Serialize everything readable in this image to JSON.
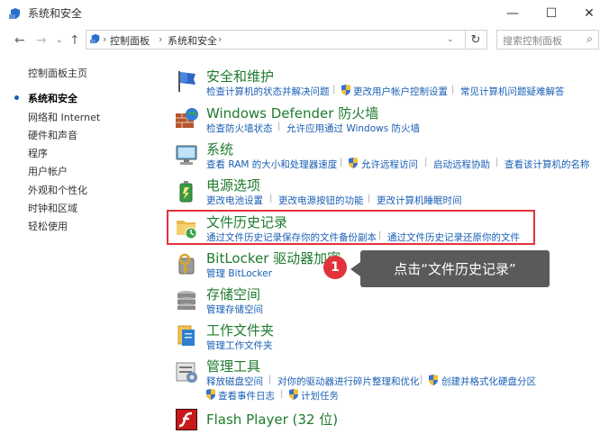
{
  "window": {
    "title": "系统和安全",
    "minimize_glyph": "—",
    "maximize_glyph": "☐",
    "close_glyph": "✕"
  },
  "nav": {
    "breadcrumb_root": "控制面板",
    "breadcrumb_current": "系统和安全",
    "search_placeholder": "搜索控制面板"
  },
  "sidebar": {
    "items": [
      {
        "label": "控制面板主页"
      },
      {
        "label": "系统和安全"
      },
      {
        "label": "网络和 Internet"
      },
      {
        "label": "硬件和声音"
      },
      {
        "label": "程序"
      },
      {
        "label": "用户帐户"
      },
      {
        "label": "外观和个性化"
      },
      {
        "label": "时钟和区域"
      },
      {
        "label": "轻松使用"
      }
    ]
  },
  "categories": [
    {
      "title": "安全和维护",
      "tasks": [
        "检查计算机的状态并解决问题",
        "更改用户帐户控制设置",
        "常见计算机问题疑难解答"
      ]
    },
    {
      "title": "Windows Defender 防火墙",
      "tasks": [
        "检查防火墙状态",
        "允许应用通过 Windows 防火墙"
      ]
    },
    {
      "title": "系统",
      "tasks": [
        "查看 RAM 的大小和处理器速度",
        "允许远程访问",
        "启动远程协助",
        "查看该计算机的名称"
      ]
    },
    {
      "title": "电源选项",
      "tasks": [
        "更改电池设置",
        "更改电源按钮的功能",
        "更改计算机睡眠时间"
      ]
    },
    {
      "title": "文件历史记录",
      "tasks": [
        "通过文件历史记录保存你的文件备份副本",
        "通过文件历史记录还原你的文件"
      ]
    },
    {
      "title": "BitLocker 驱动器加密",
      "tasks": [
        "管理 BitLocker"
      ]
    },
    {
      "title": "存储空间",
      "tasks": [
        "管理存储空间"
      ]
    },
    {
      "title": "工作文件夹",
      "tasks": [
        "管理工作文件夹"
      ]
    },
    {
      "title": "管理工具",
      "tasks": [
        "释放磁盘空间",
        "对你的驱动器进行碎片整理和优化",
        "创建并格式化硬盘分区",
        "查看事件日志",
        "计划任务"
      ]
    },
    {
      "title": "Flash Player (32 位)",
      "tasks": []
    }
  ],
  "callout": {
    "number": "1",
    "text": "点击“文件历史记录”"
  },
  "colors": {
    "accent_link": "#1a5fb4",
    "category_green": "#1e7b2e",
    "highlight_red": "#e2333a"
  }
}
